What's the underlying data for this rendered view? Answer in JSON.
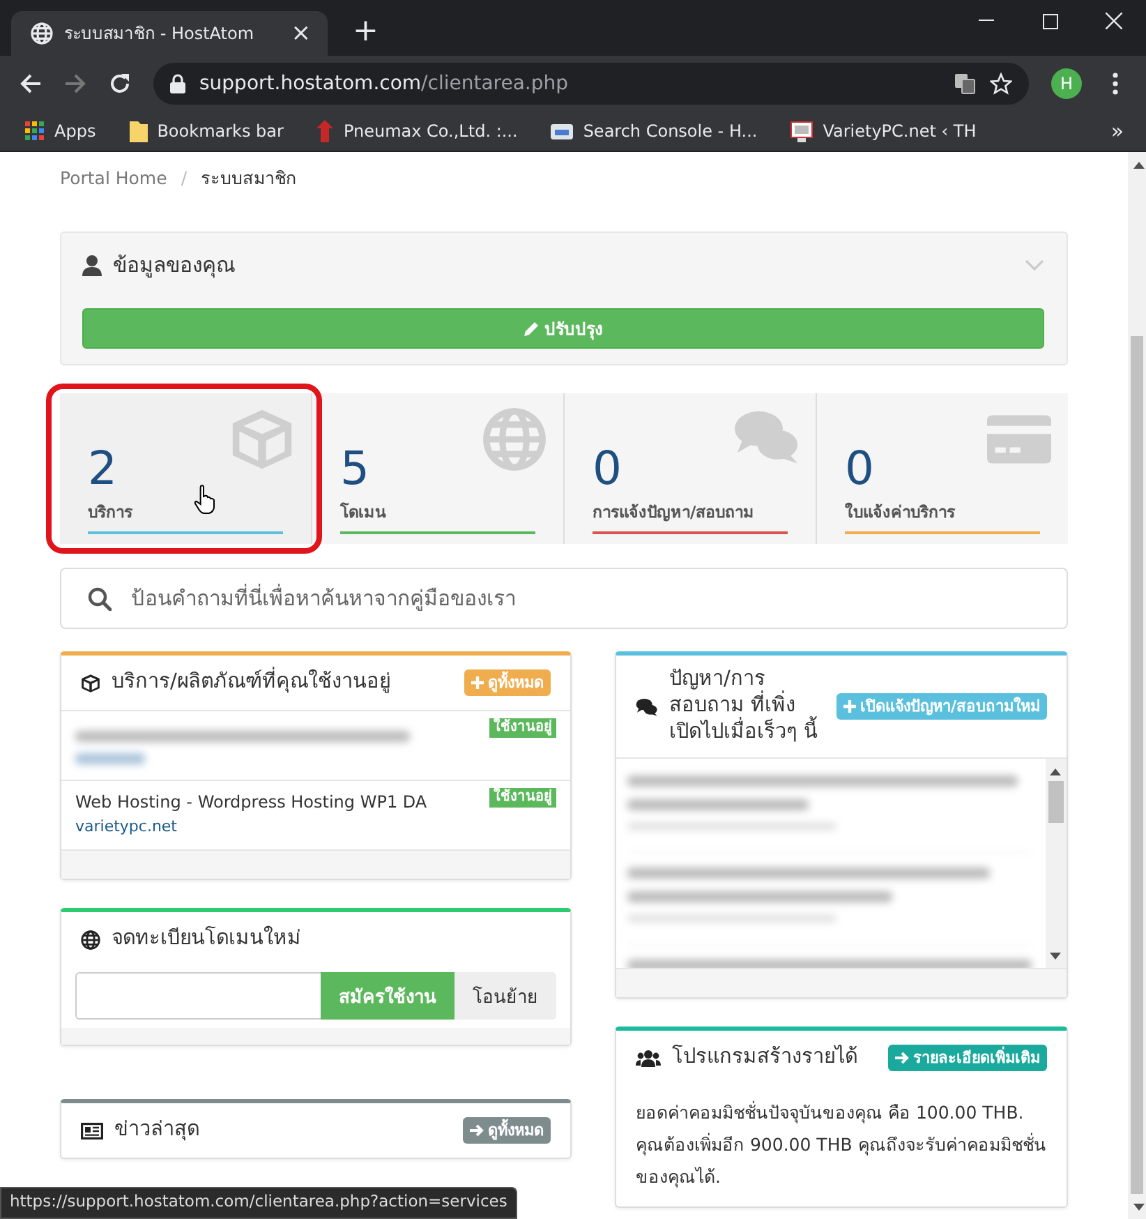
{
  "browser": {
    "tab_title": "ระบบสมาชิก - HostAtom",
    "tab_close": "×",
    "new_tab": "+",
    "url_host": "support.hostatom.com",
    "url_path": "/clientarea.php",
    "profile_initial": "H",
    "bookmarks": [
      {
        "label": "Apps",
        "kind": "apps"
      },
      {
        "label": "Bookmarks bar",
        "kind": "folder"
      },
      {
        "label": "Pneumax Co.,Ltd. :...",
        "kind": "logo"
      },
      {
        "label": "Search Console - H...",
        "kind": "console"
      },
      {
        "label": "VarietyPC.net ‹ TH",
        "kind": "monitor"
      }
    ],
    "more": "»"
  },
  "breadcrumb": [
    {
      "label": "Portal Home",
      "selected": false
    },
    {
      "label": "ระบบสมาชิก",
      "selected": true
    }
  ],
  "breadcrumb_separator": "/",
  "profile_panel": {
    "title": "ข้อมูลของคุณ",
    "button": "ปรับปรุง"
  },
  "stats": [
    {
      "count": "2",
      "label": "บริการ",
      "color": "#5bc0de",
      "selected": true
    },
    {
      "count": "5",
      "label": "โดเมน",
      "color": "#5cb85c",
      "selected": false
    },
    {
      "count": "0",
      "label": "การแจ้งปัญหา/สอบถาม",
      "color": "#d9534f",
      "selected": false
    },
    {
      "count": "0",
      "label": "ใบแจ้งค่าบริการ",
      "color": "#f0ad4e",
      "selected": false
    }
  ],
  "search": {
    "placeholder": "ป้อนคำถามที่นี่เพื่อหาค้นหาจากคู่มือของเรา"
  },
  "services_panel": {
    "title": "บริการ/ผลิตภัณฑ์ที่คุณใช้งานอยู่",
    "button": "ดูทั้งหมด",
    "rows": [
      {
        "kind": "blurred",
        "status": "ใช้งานอยู่"
      },
      {
        "kind": "plain",
        "name": "Web Hosting - Wordpress Hosting WP1 DA",
        "domain": "varietypc.net",
        "status": "ใช้งานอยู่"
      }
    ]
  },
  "domain_panel": {
    "title": "จดทะเบียนโดเมนใหม่",
    "buttons": [
      {
        "label": "สมัครใช้งาน",
        "kind": "primary"
      },
      {
        "label": "โอนย้าย",
        "kind": "default"
      }
    ]
  },
  "news_panel": {
    "title": "ข่าวล่าสุด",
    "button": "ดูทั้งหมด"
  },
  "tickets_panel": {
    "title": "ปัญหา/การสอบถาม ที่เพิ่งเปิดไปเมื่อเร็วๆ นี้",
    "button": "เปิดแจ้งปัญหา/สอบถามใหม่"
  },
  "affiliate_panel": {
    "title": "โปรแกรมสร้างรายได้",
    "button": "รายละเอียดเพิ่มเติม",
    "text": "ยอดค่าคอมมิชชั่นปัจจุบันของคุณ คือ 100.00 THB. คุณต้องเพิ่มอีก 900.00 THB คุณถึงจะรับค่าคอมมิชชั่นของคุณได้."
  },
  "status_url": "https://support.hostatom.com/clientarea.php?action=services"
}
